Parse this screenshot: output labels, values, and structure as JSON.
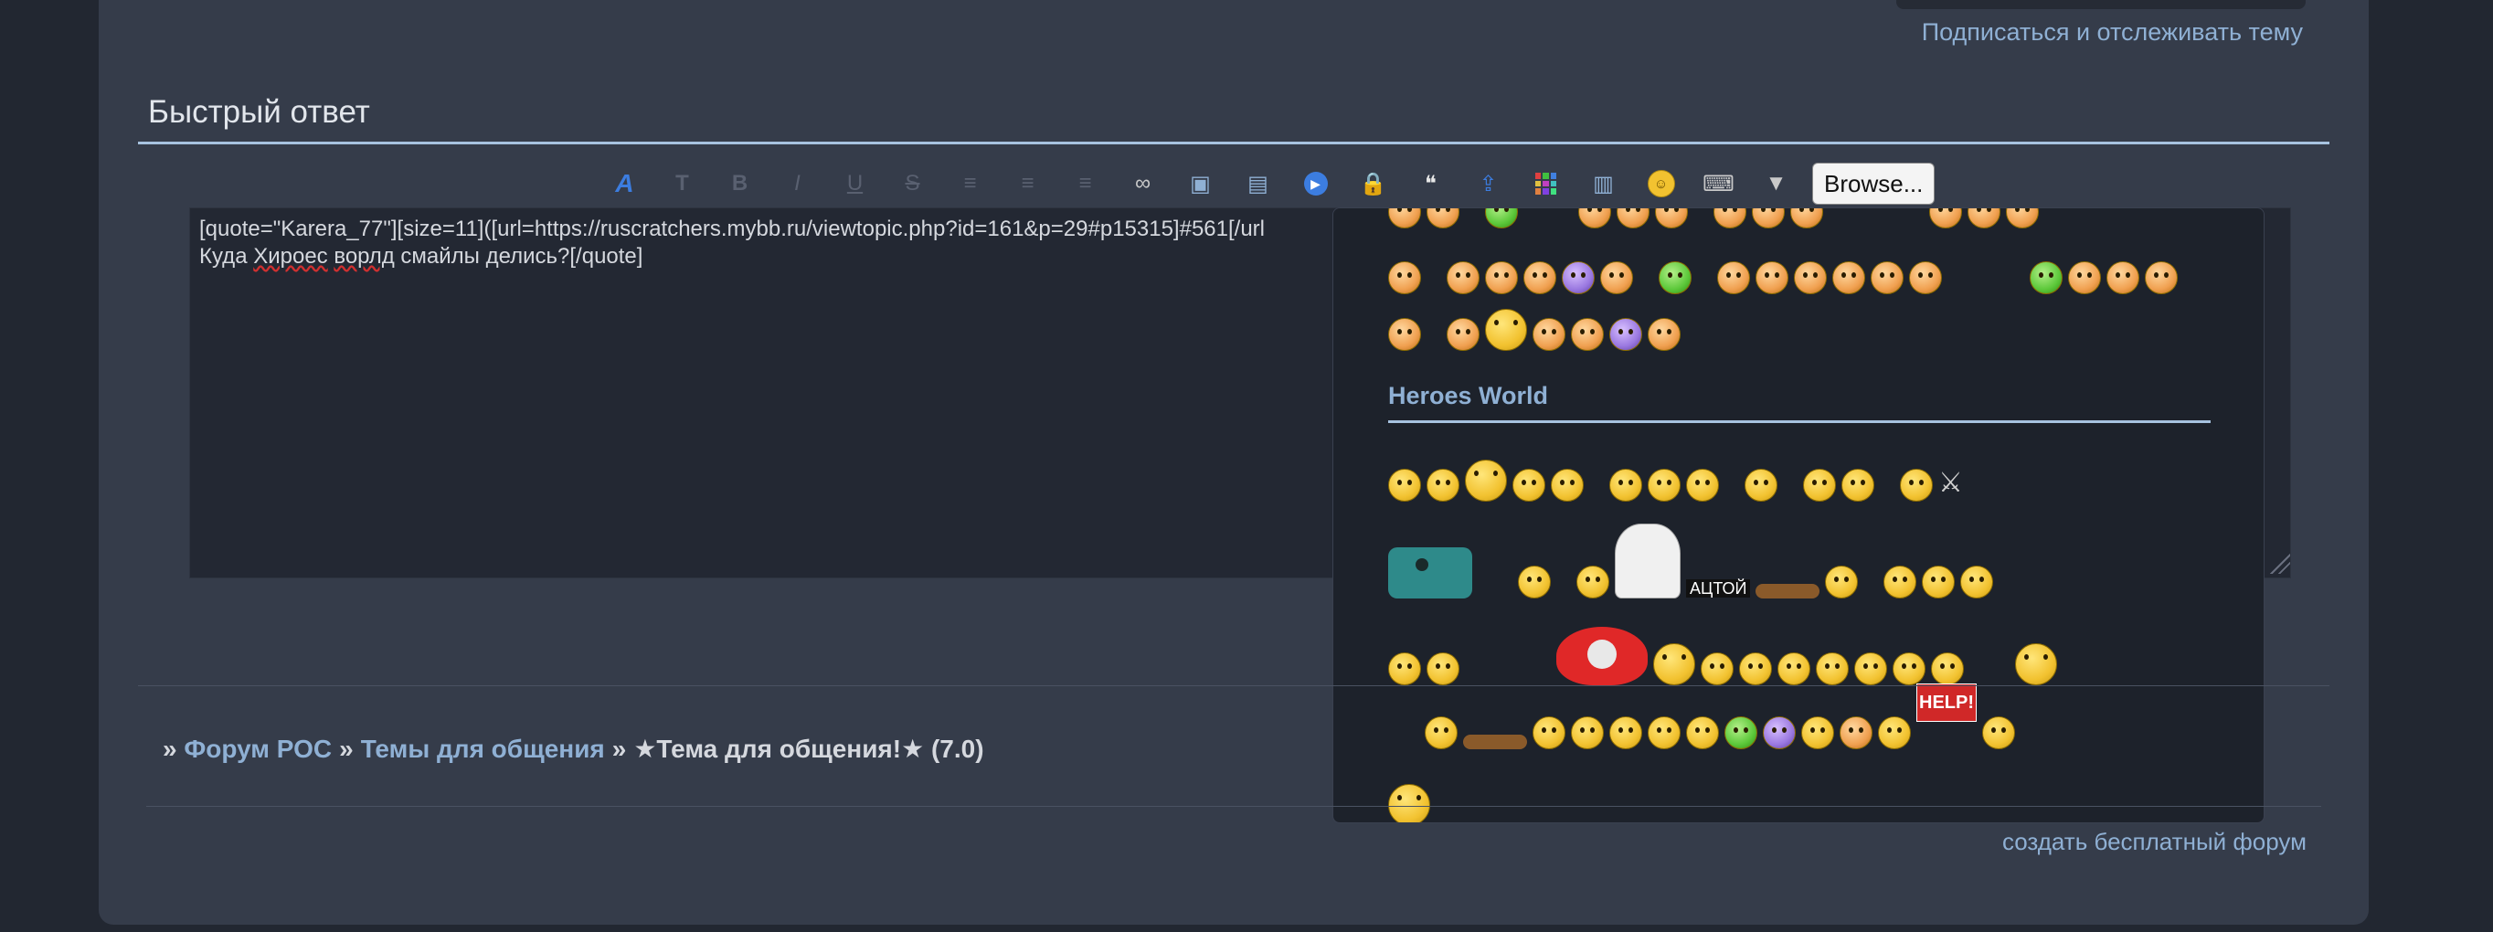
{
  "header": {
    "subscribe_link": "Подписаться и отслеживать тему"
  },
  "quick_reply": {
    "title": "Быстрый ответ",
    "toolbar": {
      "buttons": [
        {
          "name": "font-color",
          "glyph": "A"
        },
        {
          "name": "font-size",
          "glyph": "T"
        },
        {
          "name": "bold",
          "glyph": "B"
        },
        {
          "name": "italic",
          "glyph": "I"
        },
        {
          "name": "underline",
          "glyph": "U"
        },
        {
          "name": "strike",
          "glyph": "S"
        },
        {
          "name": "align-left",
          "glyph": "≡"
        },
        {
          "name": "align-center",
          "glyph": "≡"
        },
        {
          "name": "align-right",
          "glyph": "≡"
        },
        {
          "name": "link",
          "glyph": "∞"
        },
        {
          "name": "image",
          "glyph": "▣"
        },
        {
          "name": "video",
          "glyph": "▤"
        },
        {
          "name": "play",
          "glyph": "▶"
        },
        {
          "name": "hide",
          "glyph": "🔒"
        },
        {
          "name": "quote",
          "glyph": "❝"
        },
        {
          "name": "upload",
          "glyph": "⇪"
        },
        {
          "name": "table",
          "glyph": "▦"
        },
        {
          "name": "spoiler",
          "glyph": "▥"
        },
        {
          "name": "smilies",
          "glyph": "☺"
        },
        {
          "name": "code",
          "glyph": "⌨"
        },
        {
          "name": "more",
          "glyph": "▼"
        }
      ],
      "browse_label": "Browse..."
    },
    "text": {
      "line1": "[quote=\"Karera_77\"][size=11]([url=https://ruscratchers.mybb.ru/viewtopic.php?id=161&p=29#p15315]#561[/url",
      "line2_a": "Куда ",
      "line2_b": "Хироес",
      "line2_c": " ",
      "line2_d": "ворлд",
      "line2_e": " смайлы делись?[/quote]"
    }
  },
  "smilies_panel": {
    "section_title": "Heroes World",
    "actoy_label": "АЦТОЙ",
    "help_label": "HELP!"
  },
  "breadcrumbs": {
    "prefix": "»",
    "items": [
      "Форум РОС",
      "Темы для общения"
    ],
    "current": "★Тема для общения!★ (7.0)"
  },
  "footer": {
    "link": "создать бесплатный форум"
  },
  "colors": {
    "background": "#222731",
    "panel": "#353c4a",
    "accent": "#8fb0d4",
    "rule": "#a7c3e0"
  }
}
